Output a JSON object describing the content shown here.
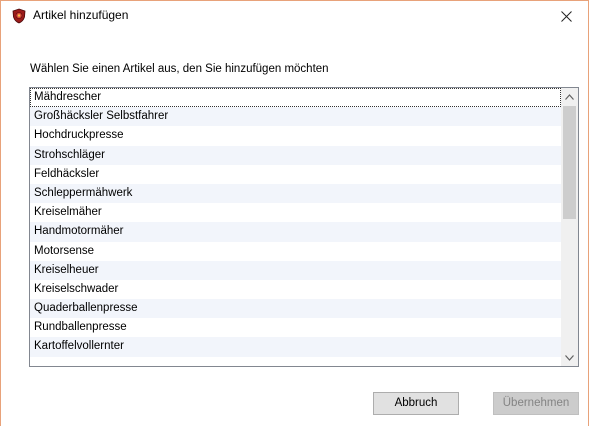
{
  "window": {
    "title": "Artikel hinzufügen",
    "close_label": "✕"
  },
  "prompt": "Wählen Sie einen Artikel aus, den Sie hinzufügen möchten",
  "list": {
    "items": [
      "Mähdrescher",
      "Großhäcksler Selbstfahrer",
      "Hochdruckpresse",
      "Strohschläger",
      "Feldhäcksler",
      "Schleppermähwerk",
      "Kreiselmäher",
      "Handmotormäher",
      "Motorsense",
      "Kreiselheuer",
      "Kreiselschwader",
      "Quaderballenpresse",
      "Rundballenpresse",
      "Kartoffelvollernter"
    ],
    "focused_index": 0
  },
  "buttons": {
    "cancel_label": "Abbruch",
    "apply_label": "Übernehmen"
  },
  "icons": {
    "app": "app-shield-icon",
    "close": "close-icon",
    "scroll_up": "chevron-up-icon",
    "scroll_down": "chevron-down-icon"
  },
  "colors": {
    "window_border": "#e8a27a",
    "list_alt_row": "#f2f5fb",
    "disabled_button": "#cccccc",
    "disabled_text": "#838383"
  }
}
